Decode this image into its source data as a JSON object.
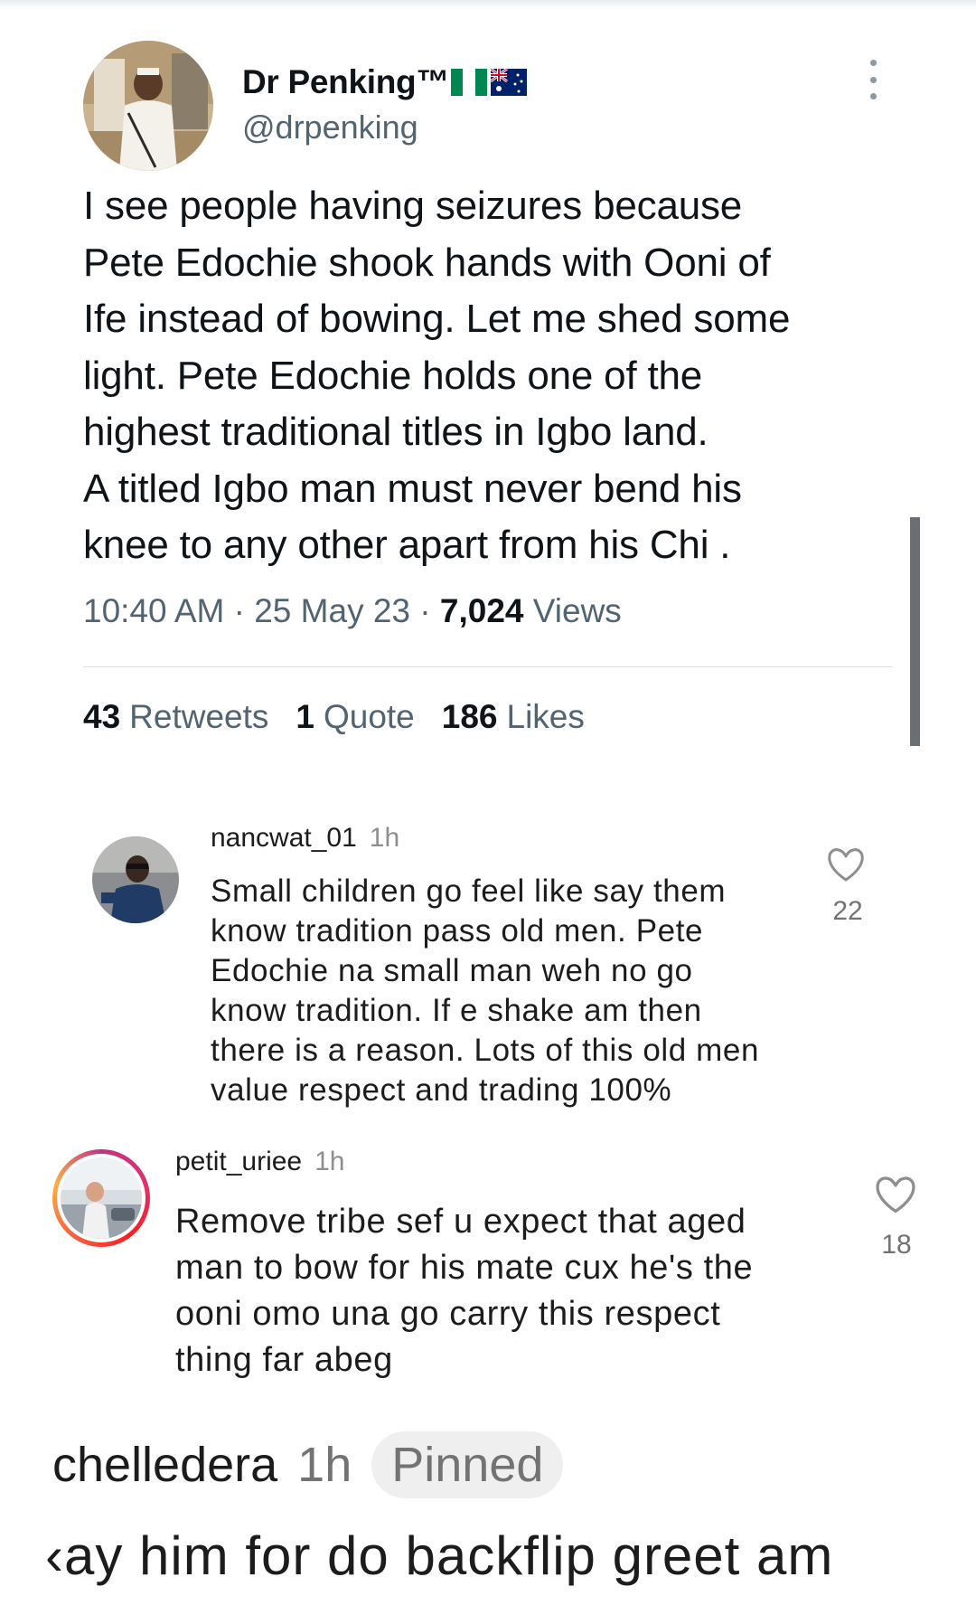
{
  "tweet": {
    "display_name": "Dr Penking™",
    "handle": "@drpenking",
    "text": "I see people having seizures because\nPete Edochie shook hands with Ooni of\nIfe instead of bowing. Let me shed some\nlight. Pete Edochie holds one of the\nhighest traditional titles in Igbo land.\nA titled Igbo man must never bend his\nknee to any other apart from his Chi .",
    "time": "10:40 AM",
    "date": "25 May 23",
    "separator": "·",
    "views_count": "7,024",
    "views_label": "Views",
    "retweets_count": "43",
    "retweets_label": "Retweets",
    "quote_count": "1",
    "quote_label": "Quote",
    "likes_count": "186",
    "likes_label": "Likes"
  },
  "comments": [
    {
      "username": "nancwat_01",
      "time": "1h",
      "text": "Small children go feel like say them\nknow tradition pass old men. Pete\nEdochie na small man weh no go\nknow tradition. If e shake am then\nthere is a reason. Lots of this old men\nvalue respect and trading 100%",
      "likes": "22"
    },
    {
      "username": "petit_uriee",
      "time": "1h",
      "text": "Remove tribe sef u expect that aged\nman to bow for his mate cux he's the\nooni omo una go carry this respect\nthing far abeg",
      "likes": "18"
    }
  ],
  "pinned_comment": {
    "username": "chelledera",
    "time": "1h",
    "badge": "Pinned",
    "text": "‹ay him for do backflip greet am"
  },
  "colors": {
    "text_primary": "#0f1419",
    "text_secondary": "#536471",
    "comment_text": "#1c1c1c",
    "pinned_badge_bg": "#efefef",
    "nigeria_green": "#008751",
    "australia_blue": "#012169"
  },
  "icons": [
    "more-vertical-icon",
    "heart-icon",
    "nigeria-flag-icon",
    "australia-flag-icon"
  ]
}
